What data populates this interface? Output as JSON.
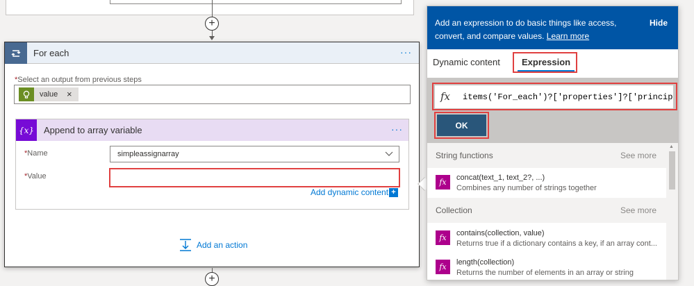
{
  "flow": {
    "foreach": {
      "title": "For each",
      "select_label": "Select an output from previous steps",
      "token_label": "value",
      "token_remove": "×"
    },
    "append": {
      "title": "Append to array variable",
      "name_label": "Name",
      "name_value": "simpleassignarray",
      "value_label": "Value",
      "value_text": "",
      "add_dynamic": "Add dynamic content",
      "add_dynamic_icon": "+"
    },
    "add_action": "Add an action",
    "required_mark": "*",
    "plus_icon": "+",
    "ellipsis": "···"
  },
  "panel": {
    "banner_text": "Add an expression to do basic things like access, convert, and compare values.",
    "learn_more": "Learn more",
    "hide": "Hide",
    "tabs": [
      {
        "label": "Dynamic content",
        "active": false
      },
      {
        "label": "Expression",
        "active": true
      }
    ],
    "fx_symbol": "fx",
    "expression": "items('For_each')?['properties']?['principalName']",
    "ok": "OK",
    "sections": [
      {
        "title": "String functions",
        "see_more": "See more",
        "items": [
          {
            "name": "concat(text_1, text_2?, ...)",
            "desc": "Combines any number of strings together"
          }
        ]
      },
      {
        "title": "Collection",
        "see_more": "See more",
        "items": [
          {
            "name": "contains(collection, value)",
            "desc": "Returns true if a dictionary contains a key, if an array cont..."
          },
          {
            "name": "length(collection)",
            "desc": "Returns the number of elements in an array or string"
          }
        ]
      }
    ]
  },
  "colors": {
    "accent": "#0078d4",
    "banner": "#0055a5",
    "foreach_icon": "#486991",
    "variable_icon": "#770bd6",
    "function_icon": "#ad008c",
    "highlight": "#e04040"
  }
}
